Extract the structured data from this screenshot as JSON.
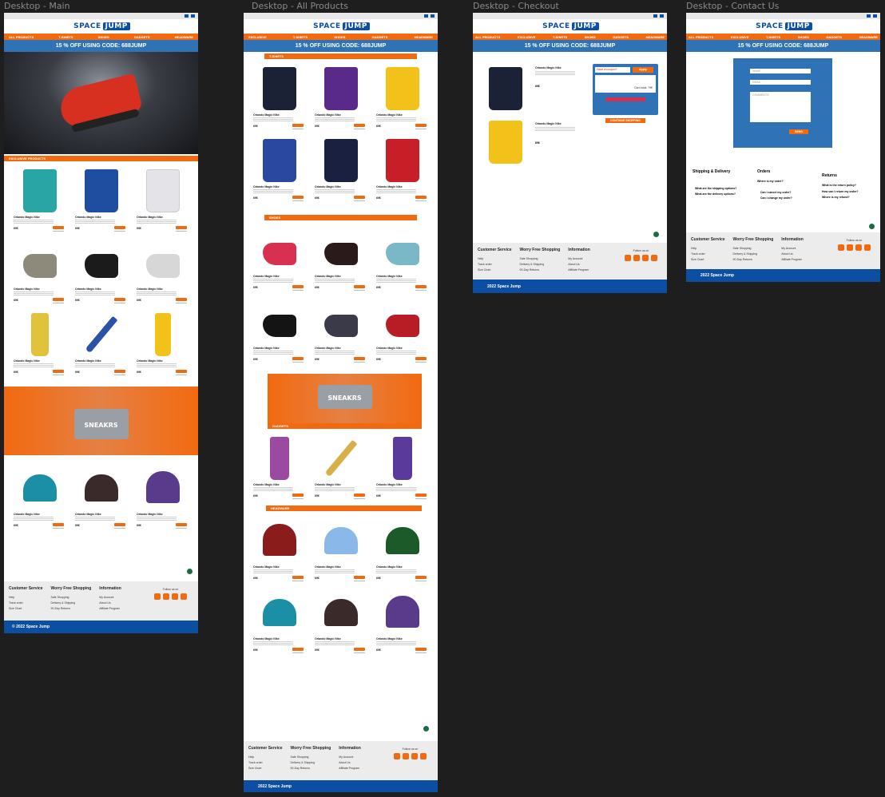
{
  "frames": {
    "main": "Desktop - Main",
    "products": "Desktop - All Products",
    "checkout": "Desktop - Checkout",
    "contact": "Desktop - Contact Us"
  },
  "brand": {
    "part1": "SPACE",
    "part2": "JUMP"
  },
  "nav_main": [
    "ALL PRODUCTS",
    "T-SHIRTS",
    "SHOES",
    "GADGETS",
    "HEADWARE"
  ],
  "nav_other": [
    "EXCLUSIVE",
    "T-SHIRTS",
    "SHOES",
    "GADGETS",
    "HEADWARE"
  ],
  "nav_full": [
    "ALL PRODUCTS",
    "EXCLUSIVE",
    "T-SHIRTS",
    "SHOES",
    "GADGETS",
    "HEADWARE"
  ],
  "promo": "15 % OFF USING CODE: 688JUMP",
  "sections": {
    "exclusive": "EXCLUSIVE PRODUCTS",
    "tshirts": "T-SHIRTS",
    "shoes": "SHOES",
    "gadgets": "GADGETS",
    "headware": "HEADWARE"
  },
  "product": {
    "title": "Orlando Magic Nike",
    "price": "69€"
  },
  "banner_text": "SNEAKRS",
  "checkout": {
    "coupon_placeholder": "Have a coupon?",
    "apply": "Apply",
    "total": "Card total: 79€",
    "continue": "CONTINUE SHOPPING"
  },
  "contact": {
    "name": "NAME",
    "email": "EMAIL",
    "comments": "COMMENTS",
    "send": "SEND",
    "shipping_title": "Shipping & Delivery",
    "shipping_q1": "What are the shipping options?",
    "shipping_q2": "What are the delivery options?",
    "orders_title": "Orders",
    "orders_q1": "Where is my order?",
    "orders_q2": "Can I cancel my order?",
    "orders_q3": "Can I change my order?",
    "returns_title": "Returns",
    "returns_q1": "What is the return policy?",
    "returns_q2": "How can I return my order?",
    "returns_q3": "Where is my refund?"
  },
  "footer": {
    "col1_title": "Customer Service",
    "col1": [
      "Help",
      "Track order",
      "Size Chart"
    ],
    "col2_title": "Worry Free Shopping",
    "col2": [
      "Safe Shopping",
      "Delivery & Shipping",
      "90-Day Returns"
    ],
    "col3_title": "Information",
    "col3": [
      "My Account",
      "About Us",
      "Affiliate Program"
    ],
    "follow": "Follow us on",
    "copy_main": "© 2022 Space Jump",
    "copy": "2022 Space Jump"
  },
  "colors": {
    "blue": "#0b4ea2",
    "orange": "#f26a10",
    "promo": "#2f72b6"
  }
}
